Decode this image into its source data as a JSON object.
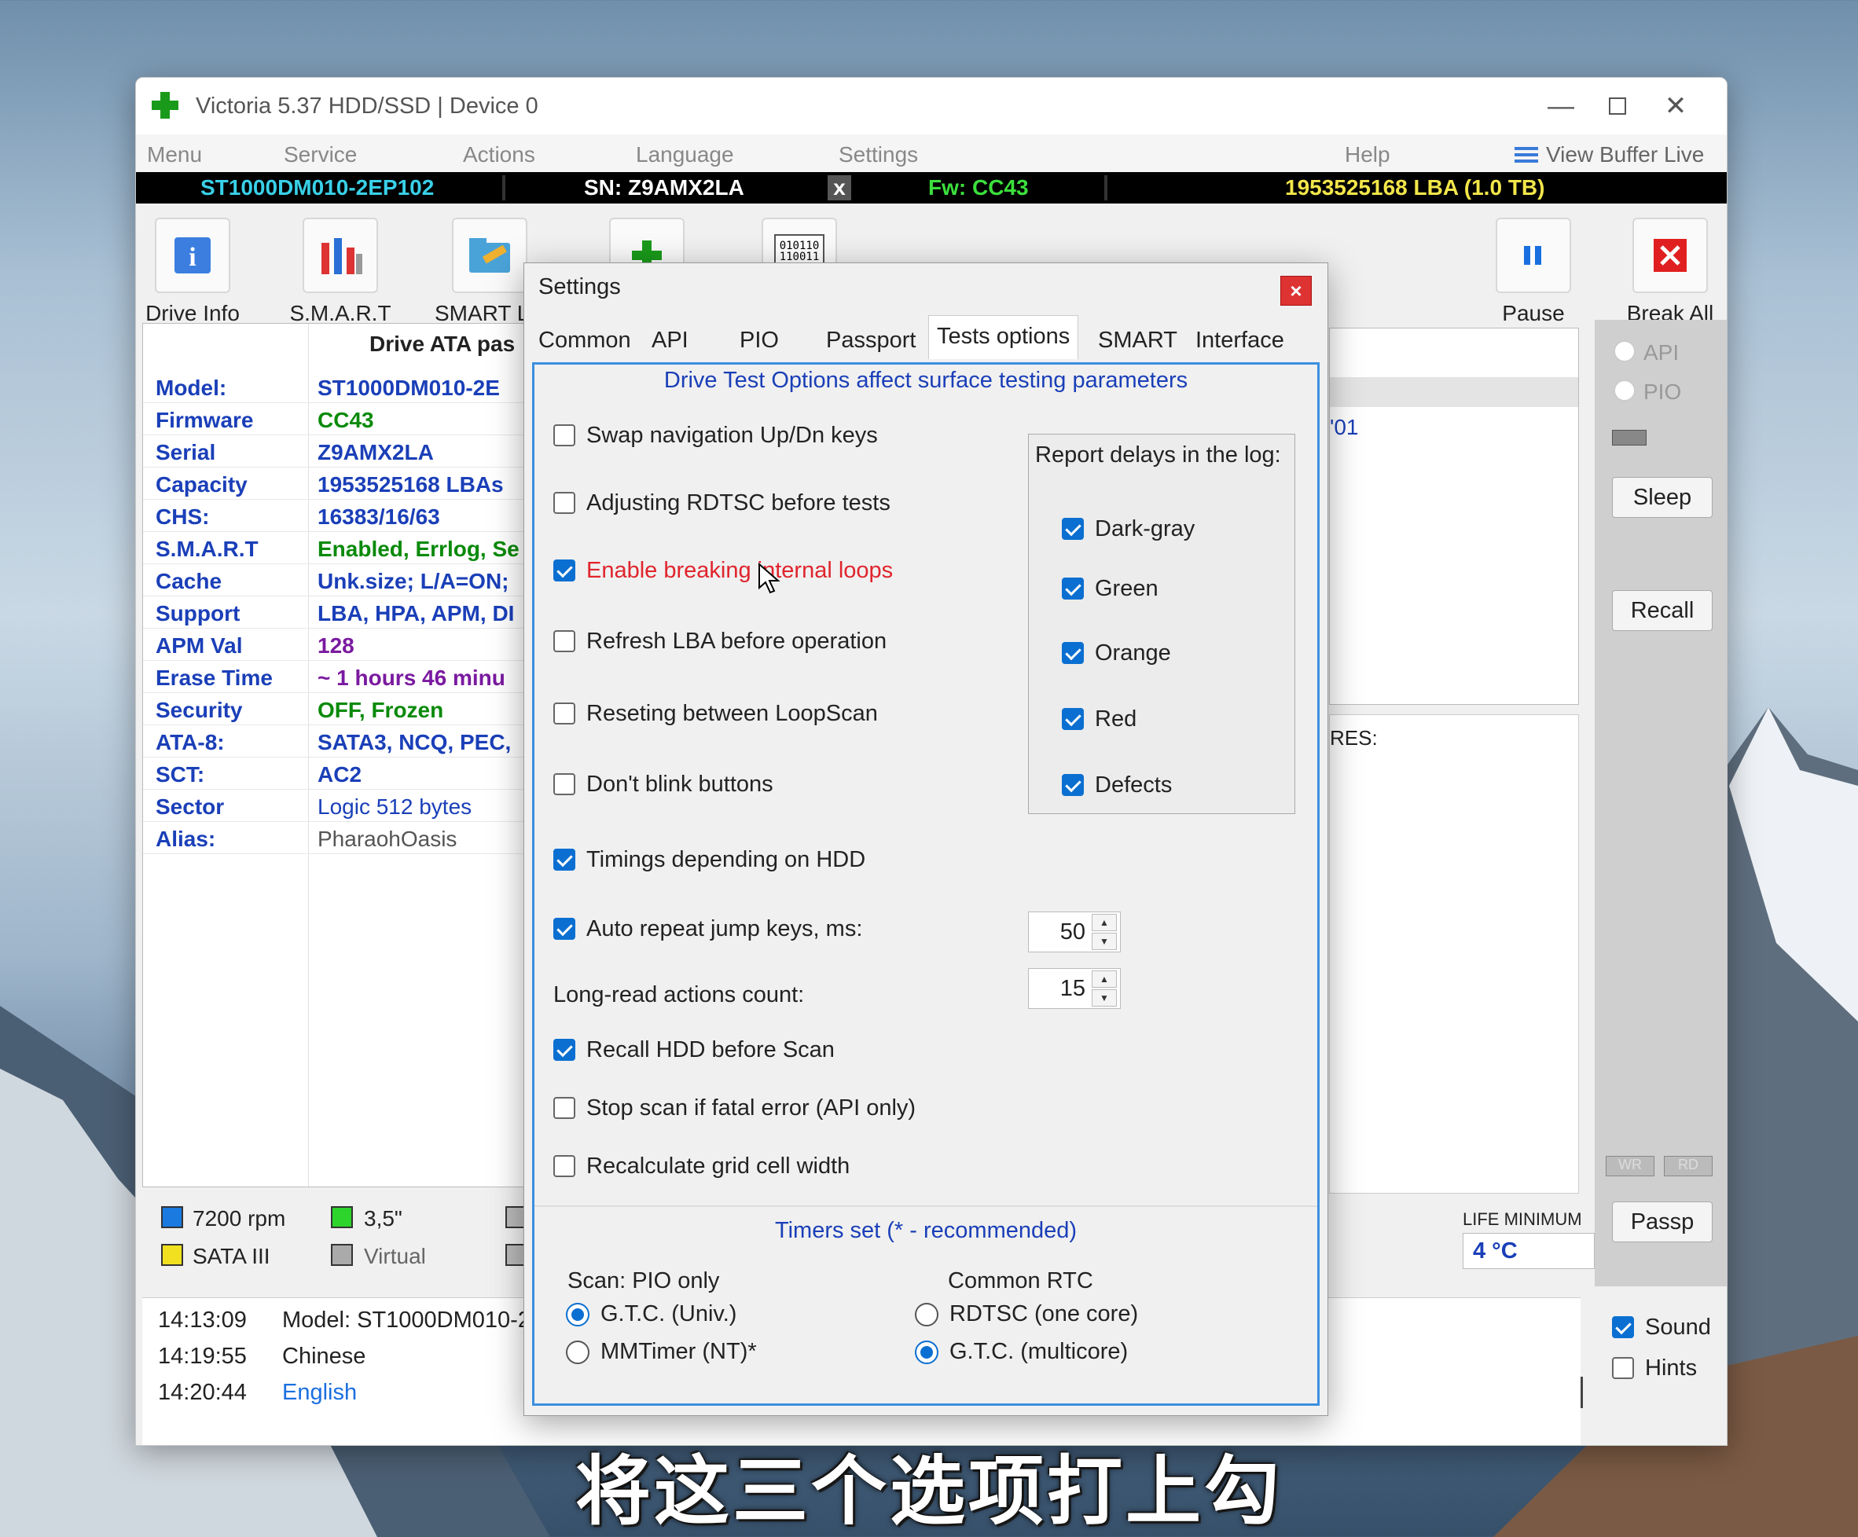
{
  "window": {
    "title": "Victoria 5.37 HDD/SSD | Device 0"
  },
  "menu": {
    "items": [
      "Menu",
      "Service",
      "Actions",
      "Language",
      "Settings",
      "Help"
    ],
    "view_buffer": "View Buffer Live"
  },
  "infobar": {
    "model": "ST1000DM010-2EP102",
    "sn": "SN: Z9AMX2LA",
    "x": "x",
    "fw": "Fw: CC43",
    "lba": "1953525168 LBA (1.0 TB)"
  },
  "toolbar": {
    "drive_info": "Drive Info",
    "smart": "S.M.A.R.T",
    "smart_log": "SMART L",
    "pause": "Pause",
    "break_all": "Break All"
  },
  "drive": {
    "header": "Drive ATA pas",
    "rows": [
      {
        "k": "Model:",
        "v": "ST1000DM010-2E"
      },
      {
        "k": "Firmware",
        "v": "CC43"
      },
      {
        "k": "Serial",
        "v": "Z9AMX2LA"
      },
      {
        "k": "Capacity",
        "v": "1953525168 LBAs"
      },
      {
        "k": "CHS:",
        "v": "16383/16/63"
      },
      {
        "k": "S.M.A.R.T",
        "v": "Enabled, Errlog, Se"
      },
      {
        "k": "Cache",
        "v": "Unk.size; L/A=ON;"
      },
      {
        "k": "Support",
        "v": "LBA, HPA, APM, DI"
      },
      {
        "k": "APM Val",
        "v": "128"
      },
      {
        "k": "Erase Time",
        "v": "~ 1 hours 46 minu"
      },
      {
        "k": "Security",
        "v": "OFF, Frozen"
      },
      {
        "k": "ATA-8:",
        "v": "SATA3, NCQ, PEC,"
      },
      {
        "k": "SCT:",
        "v": "AC2"
      },
      {
        "k": "Sector",
        "v": "Logic 512 bytes"
      },
      {
        "k": "Alias:",
        "v": "PharaohOasis"
      }
    ]
  },
  "legend": {
    "rpm": "7200 rpm",
    "size": "3,5\"",
    "sata": "SATA III",
    "virtual": "Virtual"
  },
  "log": [
    {
      "t": "14:13:09",
      "m": "Model: ST1000DM010-2"
    },
    {
      "t": "14:19:55",
      "m": "Chinese"
    },
    {
      "t": "14:20:44",
      "m": "English"
    }
  ],
  "right": {
    "api": "API",
    "pio": "PIO",
    "sleep": "Sleep",
    "recall": "Recall",
    "wr": "WR",
    "rd": "RD",
    "passp": "Passp",
    "sound": "Sound",
    "hints": "Hints"
  },
  "mid": {
    "partial1": "'01",
    "partial2": "RES:",
    "life_label": "LIFE MINIMUM",
    "life_value": "4 °C"
  },
  "dialog": {
    "title": "Settings",
    "close": "×",
    "tabs": [
      "Common",
      "API",
      "PIO",
      "Passport",
      "Tests options",
      "SMART",
      "Interface"
    ],
    "header": "Drive Test Options affect surface testing parameters",
    "options": [
      {
        "label": "Swap navigation Up/Dn keys",
        "checked": false
      },
      {
        "label": "Adjusting RDTSC before tests",
        "checked": false
      },
      {
        "label": "Enable breaking internal loops",
        "checked": true
      },
      {
        "label": "Refresh LBA before operation",
        "checked": false
      },
      {
        "label": "Reseting between LoopScan",
        "checked": false
      },
      {
        "label": "Don't blink buttons",
        "checked": false
      },
      {
        "label": "Timings depending on HDD",
        "checked": true
      },
      {
        "label": "Auto repeat jump keys, ms:",
        "checked": true
      },
      {
        "label": "Recall HDD before Scan",
        "checked": true
      },
      {
        "label": "Stop scan if fatal error (API only)",
        "checked": false
      },
      {
        "label": "Recalculate grid cell width",
        "checked": false
      }
    ],
    "long_read_label": "Long-read actions count:",
    "auto_repeat_value": "50",
    "long_read_value": "15",
    "delays": {
      "title": "Report delays in the log:",
      "items": [
        "Dark-gray",
        "Green",
        "Orange",
        "Red",
        "Defects"
      ]
    },
    "timers": {
      "title": "Timers set  (* - recommended)",
      "scan_label": "Scan: PIO only",
      "scan_opt1": "G.T.C. (Univ.)",
      "scan_opt2": "MMTimer (NT)*",
      "rtc_label": "Common RTC",
      "rtc_opt1": "RDTSC (one core)",
      "rtc_opt2": "G.T.C.  (multicore)"
    }
  },
  "subtitle": "将这三个选项打上勾",
  "colors": {
    "accent": "#0b6fd1",
    "blue_text": "#1a3fb8",
    "green_text": "#0a8a0a",
    "purple_text": "#7a1aa0",
    "red_text": "#e0242c"
  }
}
